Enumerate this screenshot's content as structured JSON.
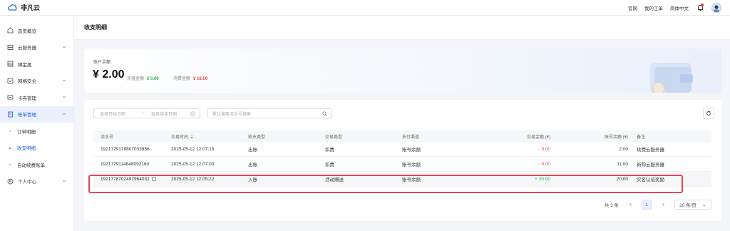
{
  "app": {
    "name": "非凡云"
  },
  "topnav": {
    "links": [
      "官网",
      "我的工单",
      "简体中文"
    ]
  },
  "sidebar": {
    "items": [
      {
        "label": "首页概览",
        "icon": "home-icon",
        "chevron": false
      },
      {
        "label": "云服务器",
        "icon": "server-icon",
        "chevron": true
      },
      {
        "label": "裸金属",
        "icon": "baremetal-icon",
        "chevron": false
      },
      {
        "label": "网络安全",
        "icon": "shield-icon",
        "chevron": true
      },
      {
        "label": "卡券管理",
        "icon": "ticket-icon",
        "chevron": true
      },
      {
        "label": "账单管理",
        "icon": "bill-icon",
        "chevron": true,
        "active": true
      }
    ],
    "subitems": [
      {
        "label": "订单明细"
      },
      {
        "label": "收支明细",
        "current": true
      },
      {
        "label": "自动续费账单"
      }
    ],
    "bottom_item": {
      "label": "个人中心",
      "icon": "user-icon"
    }
  },
  "page": {
    "title": "收支明细"
  },
  "balance": {
    "label": "账户余额",
    "amount": "¥ 2.00",
    "recharge_label": "充值金额",
    "recharge_value": "¥ 0.00",
    "spend_label": "消费金额",
    "spend_value": "¥ 18.00"
  },
  "filters": {
    "start_placeholder": "选择开始日期",
    "separator": "-",
    "end_placeholder": "选择结束日期",
    "search_placeholder": "默认搜索流水号搜索"
  },
  "table": {
    "headers": [
      "流水号",
      "交易时间",
      "收支类型",
      "交易类型",
      "支付渠道",
      "交易金额 (¥)",
      "账号余额 (¥)",
      "备注"
    ],
    "rows": [
      [
        "1921779178807033856",
        "2025-05-12 12:07:15",
        "出账",
        "扣费",
        "账号余额",
        "- 9.00",
        "2.00",
        "续费云服务器"
      ],
      [
        "1921779114848092160",
        "2025-05-12 12:07:00",
        "出账",
        "扣费",
        "账号余额",
        "- 9.00",
        "11.00",
        "新购云服务器"
      ],
      [
        "1921778702497964032",
        "2025-05-12 12:05:22",
        "入账",
        "活动赠送",
        "账号余额",
        "+ 20.00",
        "20.00",
        "实名认证奖励"
      ]
    ]
  },
  "pagination": {
    "total": "共 3 条",
    "current_page": "1",
    "page_size": "20 条/页"
  },
  "colors": {
    "accent": "#1f5fd6",
    "negative": "#e04a4a",
    "positive": "#2fb24b",
    "highlight": "#e2475c"
  }
}
